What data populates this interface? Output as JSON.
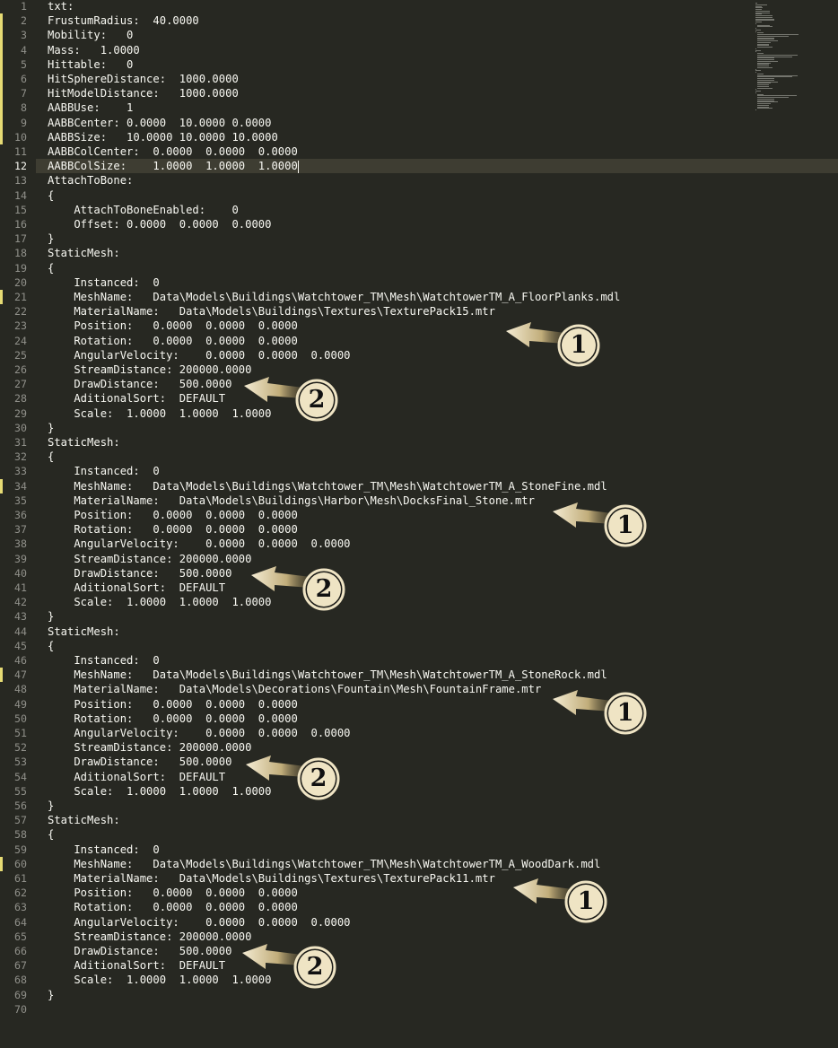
{
  "editor": {
    "current_line": 12,
    "lines": [
      "txt:",
      "FrustumRadius:  40.0000",
      "Mobility:   0",
      "Mass:   1.0000",
      "Hittable:   0",
      "HitSphereDistance:  1000.0000",
      "HitModelDistance:   1000.0000",
      "AABBUse:    1",
      "AABBCenter: 0.0000  10.0000 0.0000",
      "AABBSize:   10.0000 10.0000 10.0000",
      "AABBColCenter:  0.0000  0.0000  0.0000",
      "AABBColSize:    1.0000  1.0000  1.0000",
      "AttachToBone:",
      "{",
      "    AttachToBoneEnabled:    0",
      "    Offset: 0.0000  0.0000  0.0000",
      "}",
      "StaticMesh:",
      "{",
      "    Instanced:  0",
      "    MeshName:   Data\\Models\\Buildings\\Watchtower_TM\\Mesh\\WatchtowerTM_A_FloorPlanks.mdl",
      "    MaterialName:   Data\\Models\\Buildings\\Textures\\TexturePack15.mtr",
      "    Position:   0.0000  0.0000  0.0000",
      "    Rotation:   0.0000  0.0000  0.0000",
      "    AngularVelocity:    0.0000  0.0000  0.0000",
      "    StreamDistance: 200000.0000",
      "    DrawDistance:   500.0000",
      "    AditionalSort:  DEFAULT",
      "    Scale:  1.0000  1.0000  1.0000",
      "}",
      "StaticMesh:",
      "{",
      "    Instanced:  0",
      "    MeshName:   Data\\Models\\Buildings\\Watchtower_TM\\Mesh\\WatchtowerTM_A_StoneFine.mdl",
      "    MaterialName:   Data\\Models\\Buildings\\Harbor\\Mesh\\DocksFinal_Stone.mtr",
      "    Position:   0.0000  0.0000  0.0000",
      "    Rotation:   0.0000  0.0000  0.0000",
      "    AngularVelocity:    0.0000  0.0000  0.0000",
      "    StreamDistance: 200000.0000",
      "    DrawDistance:   500.0000",
      "    AditionalSort:  DEFAULT",
      "    Scale:  1.0000  1.0000  1.0000",
      "}",
      "StaticMesh:",
      "{",
      "    Instanced:  0",
      "    MeshName:   Data\\Models\\Buildings\\Watchtower_TM\\Mesh\\WatchtowerTM_A_StoneRock.mdl",
      "    MaterialName:   Data\\Models\\Decorations\\Fountain\\Mesh\\FountainFrame.mtr",
      "    Position:   0.0000  0.0000  0.0000",
      "    Rotation:   0.0000  0.0000  0.0000",
      "    AngularVelocity:    0.0000  0.0000  0.0000",
      "    StreamDistance: 200000.0000",
      "    DrawDistance:   500.0000",
      "    AditionalSort:  DEFAULT",
      "    Scale:  1.0000  1.0000  1.0000",
      "}",
      "StaticMesh:",
      "{",
      "    Instanced:  0",
      "    MeshName:   Data\\Models\\Buildings\\Watchtower_TM\\Mesh\\WatchtowerTM_A_WoodDark.mdl",
      "    MaterialName:   Data\\Models\\Buildings\\Textures\\TexturePack11.mtr",
      "    Position:   0.0000  0.0000  0.0000",
      "    Rotation:   0.0000  0.0000  0.0000",
      "    AngularVelocity:    0.0000  0.0000  0.0000",
      "    StreamDistance: 200000.0000",
      "    DrawDistance:   500.0000",
      "    AditionalSort:  DEFAULT",
      "    Scale:  1.0000  1.0000  1.0000",
      "}",
      ""
    ],
    "modified_lines": [
      2,
      3,
      4,
      5,
      6,
      7,
      8,
      9,
      10,
      21,
      34,
      47,
      60
    ]
  },
  "annotations": [
    {
      "label": "1",
      "line": 22
    },
    {
      "label": "2",
      "line": 27
    },
    {
      "label": "1",
      "line": 35
    },
    {
      "label": "2",
      "line": 40
    },
    {
      "label": "1",
      "line": 48
    },
    {
      "label": "2",
      "line": 53
    },
    {
      "label": "1",
      "line": 61
    },
    {
      "label": "2",
      "line": 66
    }
  ],
  "colors": {
    "background": "#272822",
    "text": "#f8f8f2",
    "gutter_text": "#90908a",
    "modified_marker": "#e6db74",
    "current_line": "#3e3d32",
    "annotation_fill": "#efe4c4"
  }
}
